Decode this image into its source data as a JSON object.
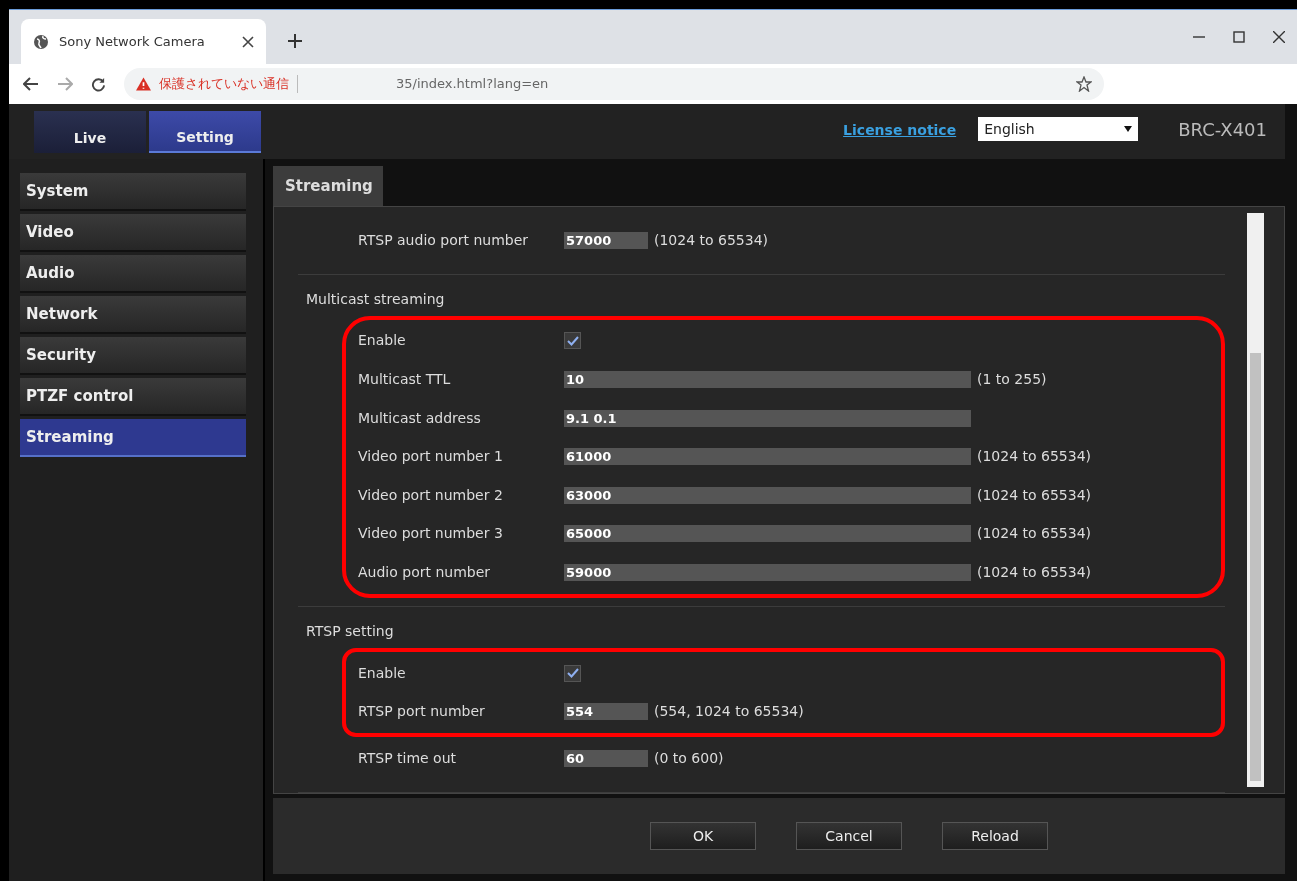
{
  "browser": {
    "tab_title": "Sony Network Camera",
    "url_warning": "保護されていない通信",
    "url": "35/index.html?lang=en"
  },
  "header": {
    "top_tabs": [
      {
        "label": "Live",
        "selected": false
      },
      {
        "label": "Setting",
        "selected": true
      }
    ],
    "license_link": "License notice",
    "language": "English",
    "model": "BRC-X401"
  },
  "sidebar": {
    "items": [
      {
        "label": "System",
        "selected": false
      },
      {
        "label": "Video",
        "selected": false
      },
      {
        "label": "Audio",
        "selected": false
      },
      {
        "label": "Network",
        "selected": false
      },
      {
        "label": "Security",
        "selected": false
      },
      {
        "label": "PTZF control",
        "selected": false
      },
      {
        "label": "Streaming",
        "selected": true
      }
    ]
  },
  "panel": {
    "tab": "Streaming",
    "sections": [
      {
        "groups": [
          {
            "highlighted": false,
            "rows": [
              {
                "kind": "input",
                "label": "RTSP audio port number",
                "value": "57000",
                "wide": false,
                "range": "(1024 to 65534)"
              }
            ]
          }
        ]
      },
      {
        "title": "Multicast streaming",
        "groups": [
          {
            "highlighted": true,
            "rows": [
              {
                "kind": "checkbox",
                "label": "Enable",
                "checked": true
              },
              {
                "kind": "input",
                "label": "Multicast TTL",
                "value": "10",
                "wide": true,
                "range": "(1 to 255)"
              },
              {
                "kind": "input",
                "label": "Multicast address",
                "value": "9.1 0.1",
                "wide": true
              },
              {
                "kind": "input",
                "label": "Video port number 1",
                "value": "61000",
                "wide": true,
                "range": "(1024 to 65534)"
              },
              {
                "kind": "input",
                "label": "Video port number 2",
                "value": "63000",
                "wide": true,
                "range": "(1024 to 65534)"
              },
              {
                "kind": "input",
                "label": "Video port number 3",
                "value": "65000",
                "wide": true,
                "range": "(1024 to 65534)"
              },
              {
                "kind": "input",
                "label": "Audio port number",
                "value": "59000",
                "wide": true,
                "range": "(1024 to 65534)"
              }
            ]
          }
        ]
      },
      {
        "title": "RTSP setting",
        "groups": [
          {
            "highlighted": true,
            "rows": [
              {
                "kind": "checkbox",
                "label": "Enable",
                "checked": true
              },
              {
                "kind": "input",
                "label": "RTSP port number",
                "value": "554",
                "wide": false,
                "range": "(554, 1024 to 65534)"
              }
            ]
          },
          {
            "highlighted": false,
            "rows": [
              {
                "kind": "input",
                "label": "RTSP time out",
                "value": "60",
                "wide": false,
                "range": "(0 to 600)"
              }
            ]
          }
        ]
      }
    ]
  },
  "buttons": [
    "OK",
    "Cancel",
    "Reload"
  ]
}
